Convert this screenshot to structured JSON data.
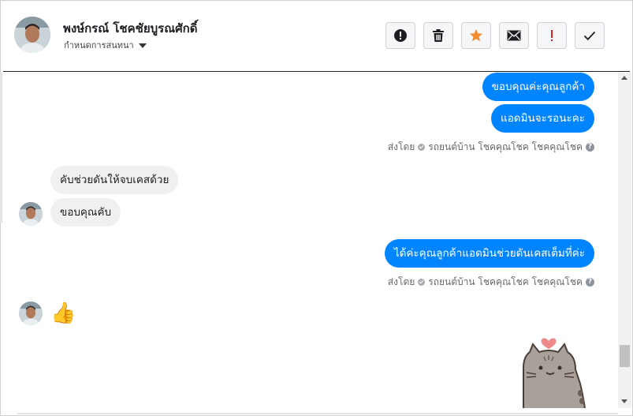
{
  "header": {
    "name": "พงษ์กรณ์ โชคชัยบูรณศักดิ์",
    "subtitle": "กำหนดการสนทนา",
    "toolbar": [
      {
        "name": "report-button",
        "icon": "exclamation-circle-icon",
        "color": "#1c1e21"
      },
      {
        "name": "delete-button",
        "icon": "trash-icon",
        "color": "#1c1e21"
      },
      {
        "name": "star-button",
        "icon": "star-icon",
        "color": "#f28b30"
      },
      {
        "name": "mark-unread-button",
        "icon": "envelope-icon",
        "color": "#1c1e21"
      },
      {
        "name": "spam-button",
        "icon": "exclamation-icon",
        "color": "#e02020"
      },
      {
        "name": "done-button",
        "icon": "check-icon",
        "color": "#1c1e21"
      }
    ]
  },
  "messages": {
    "out1": "ขอบคุณค่ะคุณลูกค้า",
    "out2": "แอดมินจะรอนะคะ",
    "sent_label": "ส่งโดย",
    "sent_by": "รถยนต์บ้าน โชคคุณโชค โชคคุณโชค",
    "in1": "คับช่วยดันให้จบเคสด้วย",
    "in2": "ขอบคุณคับ",
    "out3": "ได้ค่ะคุณลูกค้าแอดมินช่วยดันเคสเต็มที่ค่ะ",
    "thumb": "👍"
  },
  "colors": {
    "outgoing_bubble": "#0084ff",
    "incoming_bubble": "#f1f0f0"
  }
}
